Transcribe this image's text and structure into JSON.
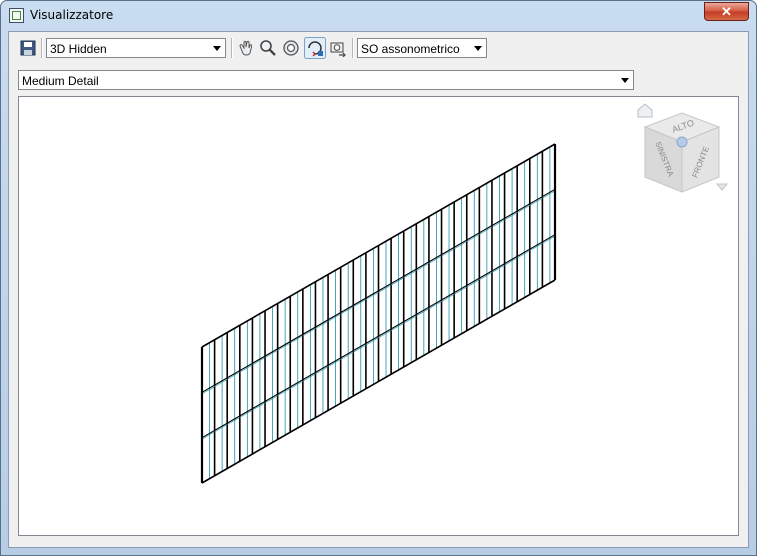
{
  "window": {
    "title": "Visualizzatore",
    "close_label": "✕"
  },
  "toolbar": {
    "save_icon": "save-icon",
    "visual_style": {
      "value": "3D Hidden"
    },
    "tools": [
      "pan-icon",
      "zoom-icon",
      "zoom-extents-icon",
      "orbit-icon",
      "camera-icon"
    ],
    "view_preset": {
      "value": "SO assonometrico"
    }
  },
  "detail_level": {
    "value": "Medium Detail"
  },
  "viewcube": {
    "faces": {
      "top": "ALTO",
      "left": "SINISTRA",
      "front": "FRONTE"
    },
    "home_icon": "home-icon",
    "menu_icon": "chevron-down-icon"
  },
  "colors": {
    "frame": "#b7cde6",
    "close": "#c9432b",
    "model_line": "#000000",
    "model_accent": "#1c8fa8"
  }
}
